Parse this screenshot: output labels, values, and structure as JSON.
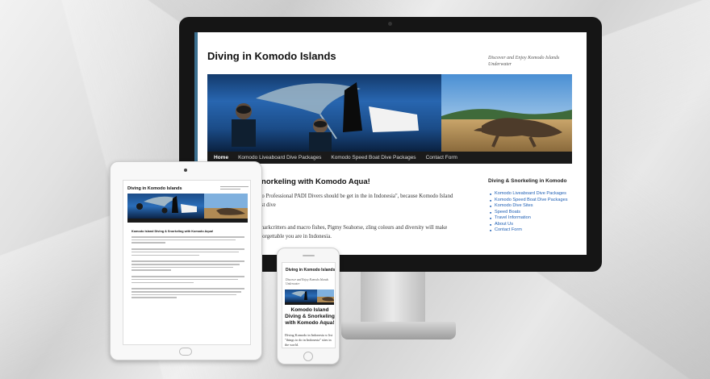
{
  "site": {
    "title": "Diving in Komodo Islands",
    "description": "Discover and Enjoy Komodo Islands Underwater"
  },
  "nav": [
    "Home",
    "Komodo Liveaboard Dive Packages",
    "Komodo Speed Boat Dive Packages",
    "Contact Form"
  ],
  "main": {
    "title": "and Diving & Snorkeling with Komodo Aqua!",
    "p1": "n Indonesia with Komodo Professional PADI Divers should be get in the in Indonesia\", because Komodo Island stands one among the best dive",
    "p2": "f Pelagics, Manta Ray, Sharkcritters and macro fishes, Pigmy Seahorse, zling colours and diversity will make diving Komodo truly unforgettable you are in Indonesia."
  },
  "sidebar": {
    "title": "Diving & Snorkeling in Komodo",
    "items": [
      "Komodo Liveaboard Dive Packages",
      "Komodo Speed Boat Dive Packages",
      "Komodo Dive Sites",
      "Speed Boats",
      "Travel Information",
      "About Us",
      "Contact Form"
    ]
  },
  "ipad": {
    "title": "Diving in Komodo Islands",
    "heading": "Komodo Island Diving & Snorkeling with Komodo Aqua!"
  },
  "iphone": {
    "title": "Diving in Komodo Islands",
    "description": "Discover and Enjoy Komodo Islands Underwater",
    "heading": "Komodo Island Diving & Snorkeling with Komodo Aqua!",
    "paragraph": "Diving Komodo in Indonesia w list \"things to do in Indonesia\" sites in the world."
  },
  "colors": {
    "link": "#1e5fb4",
    "nav_bg": "#1a1a1a",
    "bezel": "#151515"
  }
}
